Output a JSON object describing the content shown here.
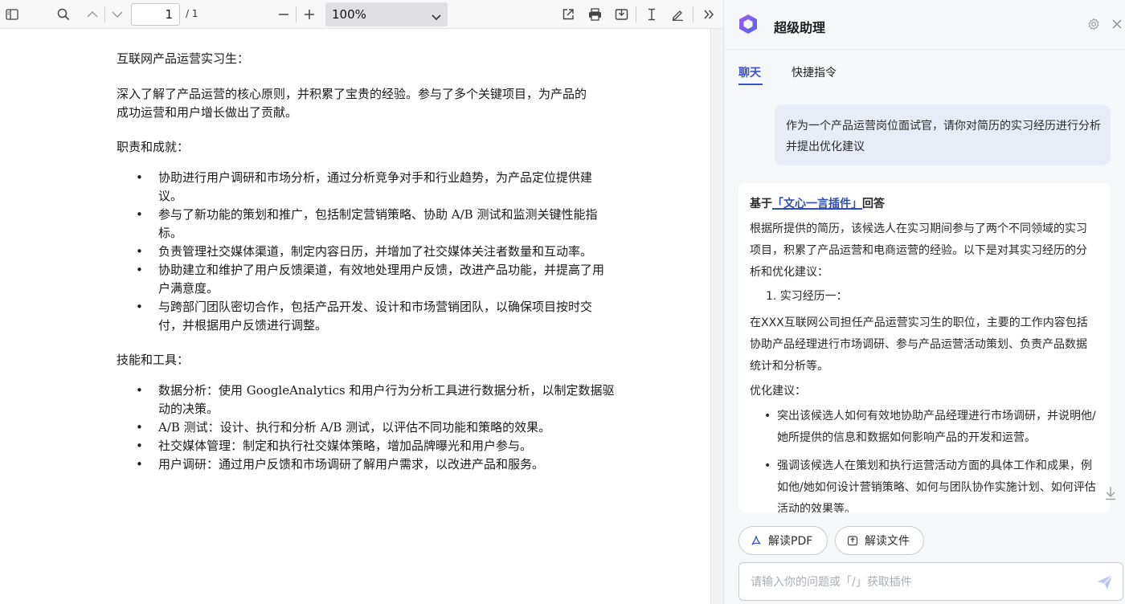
{
  "toolbar": {
    "page_current": "1",
    "page_total": "/ 1",
    "zoom": "100%"
  },
  "document": {
    "heading": "互联网产品运营实习生：",
    "intro": "深入了解了产品运营的核心原则，并积累了宝贵的经验。参与了多个关键项目，为产品的成功运营和用户增长做出了贡献。",
    "duties_title": "职责和成就：",
    "duties": [
      "协助进行用户调研和市场分析，通过分析竞争对手和行业趋势，为产品定位提供建议。",
      "参与了新功能的策划和推广，包括制定营销策略、协助 A/B 测试和监测关键性能指标。",
      "负责管理社交媒体渠道，制定内容日历，并增加了社交媒体关注者数量和互动率。",
      "协助建立和维护了用户反馈渠道，有效地处理用户反馈，改进产品功能，并提高了用户满意度。",
      "与跨部门团队密切合作，包括产品开发、设计和市场营销团队，以确保项目按时交付，并根据用户反馈进行调整。"
    ],
    "skills_title": "技能和工具：",
    "skills": [
      "数据分析：使用 GoogleAnalytics 和用户行为分析工具进行数据分析，以制定数据驱动的决策。",
      "A/B 测试：设计、执行和分析 A/B 测试，以评估不同功能和策略的效果。",
      "社交媒体管理：制定和执行社交媒体策略，增加品牌曝光和用户参与。",
      "用户调研：通过用户反馈和市场调研了解用户需求，以改进产品和服务。"
    ]
  },
  "assistant": {
    "title": "超级助理",
    "tabs": [
      "聊天",
      "快捷指令"
    ],
    "user_message": "作为一个产品运营岗位面试官，请你对简历的实习经历进行分析并提出优化建议",
    "answer": {
      "title_prefix": "基于",
      "plugin": "「文心一言插件」",
      "title_suffix": "回答",
      "para1": "根据所提供的简历，该候选人在实习期间参与了两个不同领域的实习项目，积累了产品运营和电商运营的经验。以下是对其实习经历的分析和优化建议：",
      "item1": "1. 实习经历一：",
      "para2": "在XXX互联网公司担任产品运营实习生的职位，主要的工作内容包括协助产品经理进行市场调研、参与产品运营活动策划、负责产品数据统计和分析等。",
      "label": "优化建议：",
      "bullets": [
        "突出该候选人如何有效地协助产品经理进行市场调研，并说明他/她所提供的信息和数据如何影响产品的开发和运营。",
        "强调该候选人在策划和执行运营活动方面的具体工作和成果，例如他/她如何设计营销策略、如何与团队协作实施计划、如何评估活动的效果等。"
      ]
    },
    "chips": [
      "解读PDF",
      "解读文件"
    ],
    "input_placeholder": "请输入你的问题或「/」获取插件"
  },
  "colors": {
    "accent": "#3a55c9",
    "user_bubble": "#e8ecf6",
    "panel_bg": "#f6f7f9"
  }
}
